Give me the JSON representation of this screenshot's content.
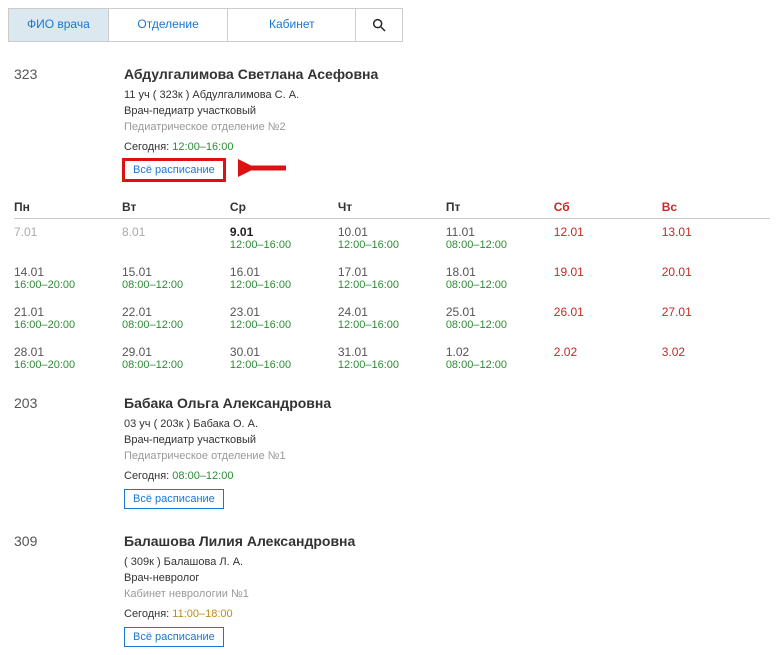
{
  "tabs": {
    "fio": "ФИО врача",
    "department": "Отделение",
    "cabinet": "Кабинет"
  },
  "doctors": [
    {
      "room": "323",
      "name": "Абдулгалимова Светлана Асефовна",
      "sub": "11 уч ( 323к ) Абдулгалимова С. А.",
      "role": "Врач-педиатр участковый",
      "dep": "Педиатрическое отделение №2",
      "todayLabel": "Сегодня:",
      "todayTime": "12:00–16:00",
      "timeClass": "",
      "btn": "Всё расписание",
      "highlight": true
    },
    {
      "room": "203",
      "name": "Бабака Ольга Александровна",
      "sub": "03 уч ( 203к ) Бабака О. А.",
      "role": "Врач-педиатр участковый",
      "dep": "Педиатрическое отделение №1",
      "todayLabel": "Сегодня:",
      "todayTime": "08:00–12:00",
      "timeClass": "",
      "btn": "Всё расписание",
      "highlight": false
    },
    {
      "room": "309",
      "name": "Балашова Лилия Александровна",
      "sub": "( 309к ) Балашова Л. А.",
      "role": "Врач-невролог",
      "dep": "Кабинет неврологии №1",
      "todayLabel": "Сегодня:",
      "todayTime": "11:00–18:00",
      "timeClass": "orange",
      "btn": "Всё расписание",
      "highlight": false
    }
  ],
  "days": [
    "Пн",
    "Вт",
    "Ср",
    "Чт",
    "Пт",
    "Сб",
    "Вс"
  ],
  "weeks": [
    [
      {
        "d": "7.01",
        "cls": "gray"
      },
      {
        "d": "8.01",
        "cls": "gray"
      },
      {
        "d": "9.01",
        "cls": "bold",
        "s": "12:00–16:00"
      },
      {
        "d": "10.01",
        "s": "12:00–16:00"
      },
      {
        "d": "11.01",
        "s": "08:00–12:00"
      },
      {
        "d": "12.01",
        "cls": "red"
      },
      {
        "d": "13.01",
        "cls": "red"
      }
    ],
    [
      {
        "d": "14.01",
        "s": "16:00–20:00"
      },
      {
        "d": "15.01",
        "s": "08:00–12:00"
      },
      {
        "d": "16.01",
        "s": "12:00–16:00"
      },
      {
        "d": "17.01",
        "s": "12:00–16:00"
      },
      {
        "d": "18.01",
        "s": "08:00–12:00"
      },
      {
        "d": "19.01",
        "cls": "red"
      },
      {
        "d": "20.01",
        "cls": "red"
      }
    ],
    [
      {
        "d": "21.01",
        "s": "16:00–20:00"
      },
      {
        "d": "22.01",
        "s": "08:00–12:00"
      },
      {
        "d": "23.01",
        "s": "12:00–16:00"
      },
      {
        "d": "24.01",
        "s": "12:00–16:00"
      },
      {
        "d": "25.01",
        "s": "08:00–12:00"
      },
      {
        "d": "26.01",
        "cls": "red"
      },
      {
        "d": "27.01",
        "cls": "red"
      }
    ],
    [
      {
        "d": "28.01",
        "s": "16:00–20:00"
      },
      {
        "d": "29.01",
        "s": "08:00–12:00"
      },
      {
        "d": "30.01",
        "s": "12:00–16:00"
      },
      {
        "d": "31.01",
        "s": "12:00–16:00"
      },
      {
        "d": "1.02",
        "s": "08:00–12:00"
      },
      {
        "d": "2.02",
        "cls": "red"
      },
      {
        "d": "3.02",
        "cls": "red"
      }
    ]
  ]
}
